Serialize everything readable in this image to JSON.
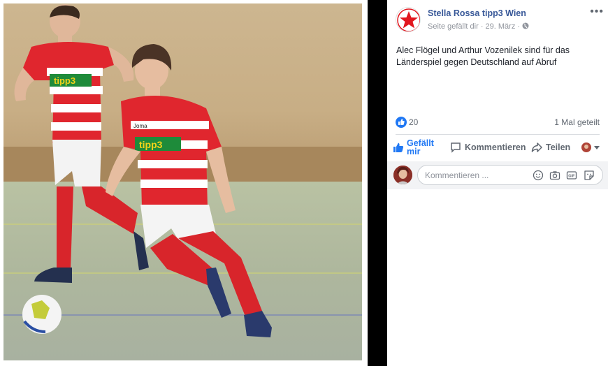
{
  "post": {
    "page_name": "Stella Rossa tipp3 Wien",
    "meta_text": "Seite gefällt dir · 29. März · ",
    "globe_icon": "globe-icon",
    "text_line1": "Alec Flögel und Arthur Vozenilek sind für das",
    "text_line2": "Länderspiel gegen Deutschland auf Abruf",
    "more_label": "•••"
  },
  "photo": {
    "jersey_sponsor": "tipp3",
    "kit_brand": "Joma"
  },
  "stats": {
    "like_count": "20",
    "shares": "1 Mal geteilt"
  },
  "actions": {
    "like_line1": "Gefällt",
    "like_line2": "mir",
    "comment": "Kommentieren",
    "share": "Teilen"
  },
  "comment": {
    "placeholder": "Kommentieren ..."
  },
  "colors": {
    "link": "#385898",
    "like_blue": "#2078f4",
    "jersey_red": "#e0262e",
    "logo_red": "#e2161e"
  }
}
